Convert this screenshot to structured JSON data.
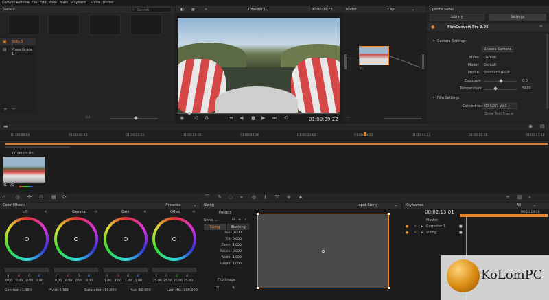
{
  "menu": [
    "DaVinci Resolve",
    "File",
    "Edit",
    "View",
    "Mark",
    "Playback",
    "Color",
    "Nodes"
  ],
  "gallery": {
    "title": "Gallery",
    "search_placeholder": "Search",
    "stills": "Stills 1",
    "powergrade": "PowerGrade 1"
  },
  "viewer": {
    "timeline": "Timeline 1",
    "timecode_top": "00:00:00:73",
    "timecode": "01:00:39:22"
  },
  "nodes": {
    "title": "Nodes",
    "clip": "Clip",
    "node_label": "01"
  },
  "openfx": {
    "title": "OpenFX Panel",
    "tab_library": "Library",
    "tab_settings": "Settings",
    "plugin": "FilmConvert Pro 2.06",
    "camera_settings": "Camera Settings",
    "choose_camera": "Choose Camera",
    "make_label": "Make:",
    "make_value": "Default",
    "model_label": "Model:",
    "model_value": "Default",
    "profile_label": "Profile:",
    "profile_value": "Standard sRGB",
    "exposure_label": "Exposure:",
    "exposure_value": "0.0",
    "temperature_label": "Temperature:",
    "temperature_value": "5600",
    "film_settings": "Film Settings",
    "convert_label": "Convert to:",
    "convert_value": "KD 5207 Vis3",
    "cut_label": "Show Text Frame"
  },
  "timeline": {
    "ticks": [
      "01:00:00:00",
      "01:00:06:10",
      "01:00:12:20",
      "01:00:19:06",
      "01:00:25:16",
      "01:00:32:02",
      "01:00:38:12",
      "01:00:44:22",
      "01:00:51:08",
      "01:00:57:18"
    ],
    "clip_timecode": "00:00:00:00",
    "clip_label": "01",
    "track": "V1"
  },
  "color_wheels": {
    "title": "Color Wheels",
    "mode": "Primaries",
    "wheels": [
      {
        "name": "Lift",
        "values": [
          "0.00",
          "0.00",
          "0.00",
          "0.00"
        ]
      },
      {
        "name": "Gamma",
        "values": [
          "0.00",
          "0.00",
          "0.00",
          "0.00"
        ]
      },
      {
        "name": "Gain",
        "values": [
          "1.00",
          "1.00",
          "1.00",
          "1.00"
        ]
      },
      {
        "name": "Offset",
        "values": [
          "25.00",
          "25.00",
          "25.00",
          "25.00"
        ]
      }
    ],
    "channels": [
      "Y",
      "R",
      "G",
      "B"
    ],
    "contrast": "Contrast: 1.000",
    "pivot": "Pivot: 0.500",
    "saturation": "Saturation: 50.000",
    "hue": "Hue: 50.000",
    "lummix": "Lum Mix: 100.000"
  },
  "sizing": {
    "title": "Sizing",
    "input": "Input Sizing",
    "presets": "Presets",
    "preset_value": "None",
    "tab_sizing": "Sizing",
    "tab_blanking": "Blanking",
    "params": [
      {
        "label": "Pan:",
        "value": "0.000"
      },
      {
        "label": "Tilt:",
        "value": "0.000"
      },
      {
        "label": "Zoom:",
        "value": "1.000"
      },
      {
        "label": "Rotate:",
        "value": "0.000"
      },
      {
        "label": "Width:",
        "value": "1.000"
      },
      {
        "label": "Height:",
        "value": "1.000"
      }
    ],
    "flip": "Flip Image"
  },
  "keyframes": {
    "title": "Keyframes",
    "filter": "All",
    "timecode": "00:02:13:01",
    "right_tc": "00:20:10:10",
    "rows": [
      "Master",
      "Corrector 1",
      "Sizing"
    ]
  },
  "watermark": "KoLomPC"
}
